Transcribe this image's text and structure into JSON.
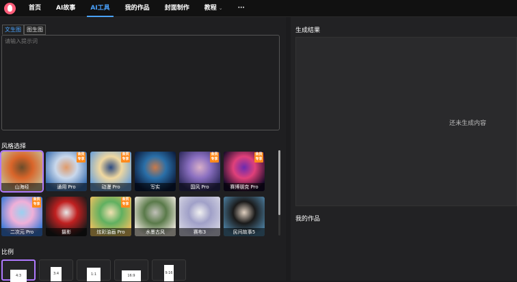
{
  "nav": {
    "items": [
      {
        "label": "首页"
      },
      {
        "label": "AI故事"
      },
      {
        "label": "AI工具"
      },
      {
        "label": "我的作品"
      },
      {
        "label": "封面制作"
      },
      {
        "label": "教程"
      },
      {
        "label": "···"
      }
    ],
    "active_index": 2
  },
  "tabs": [
    {
      "label": "文生图"
    },
    {
      "label": "图生图"
    }
  ],
  "prompt": {
    "placeholder": "请输入提示词",
    "value": ""
  },
  "styles_title": "风格选择",
  "styles": [
    {
      "label": "山海经",
      "badge": "",
      "colors": [
        "#c8b58a",
        "#d9652a",
        "#6b4c2a"
      ]
    },
    {
      "label": "通用 Pro",
      "badge": "会员\n专享",
      "colors": [
        "#3b6fb0",
        "#c9d8ec",
        "#e09a6a"
      ]
    },
    {
      "label": "动漫 Pro",
      "badge": "会员\n专享",
      "colors": [
        "#6ba0d8",
        "#f0d8a0",
        "#2c4a80"
      ]
    },
    {
      "label": "写实",
      "badge": "",
      "colors": [
        "#0b1a3a",
        "#2a6fa8",
        "#c97a4a"
      ]
    },
    {
      "label": "国风 Pro",
      "badge": "会员\n专享",
      "colors": [
        "#2e2a5c",
        "#8a6fc0",
        "#d9b0c8"
      ]
    },
    {
      "label": "赛博朋克 Pro",
      "badge": "会员\n专享",
      "colors": [
        "#150a28",
        "#e0407a",
        "#6a2ab0"
      ]
    },
    {
      "label": "二次元 Pro",
      "badge": "会员\n专享",
      "colors": [
        "#3a7ad8",
        "#f0b0d8",
        "#9ad0f0"
      ]
    },
    {
      "label": "摄影",
      "badge": "",
      "colors": [
        "#1a1a1a",
        "#c02020",
        "#e8e8e8"
      ]
    },
    {
      "label": "炫彩油画 Pro",
      "badge": "会员\n专享",
      "colors": [
        "#e8c060",
        "#60b060",
        "#f0e0b0"
      ]
    },
    {
      "label": "水墨古风",
      "badge": "",
      "colors": [
        "#e8e4d8",
        "#5a7a4a",
        "#c0c0b8"
      ]
    },
    {
      "label": "赛布3",
      "badge": "",
      "colors": [
        "#d0d0e0",
        "#a0a0c8",
        "#f0f0f0"
      ]
    },
    {
      "label": "民间故事5",
      "badge": "",
      "colors": [
        "#4a7a9a",
        "#1a1a1a",
        "#e0d0c0"
      ]
    }
  ],
  "ratio_title": "比例",
  "ratios": [
    {
      "label": "4:3",
      "selected": true
    },
    {
      "label": "3:4",
      "selected": false
    },
    {
      "label": "1:1",
      "selected": false
    },
    {
      "label": "16:9",
      "selected": false
    },
    {
      "label": "9:16",
      "selected": false
    }
  ],
  "result": {
    "title": "生成结果",
    "empty_text": "还未生成内容"
  },
  "works": {
    "title": "我的作品"
  },
  "colors": {
    "accent": "#4aa3ff",
    "selection": "#b07aff",
    "badge": "#ff8a1c"
  }
}
